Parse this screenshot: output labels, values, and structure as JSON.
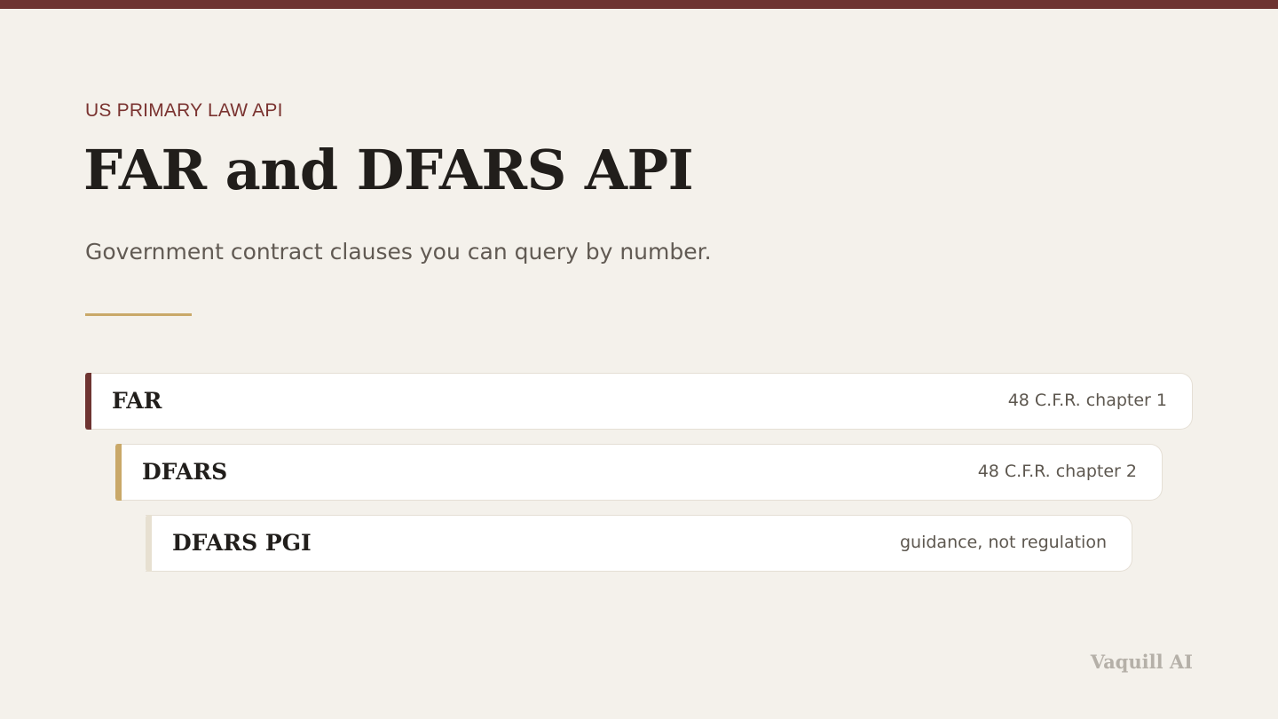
{
  "header": {
    "eyebrow": "US PRIMARY LAW API",
    "title": "FAR and DFARS API",
    "subtitle": "Government contract clauses you can query by number."
  },
  "regulations": [
    {
      "name": "FAR",
      "citation": "48 C.F.R. chapter 1",
      "accent_color": "#6e3431"
    },
    {
      "name": "DFARS",
      "citation": "48 C.F.R. chapter 2",
      "accent_color": "#c9a868"
    },
    {
      "name": "DFARS PGI",
      "citation": "guidance, not regulation",
      "accent_color": "#e7e0d1"
    }
  ],
  "footer": {
    "brand": "Vaquill AI"
  },
  "colors": {
    "brand": "#6e3431",
    "accent": "#c9a868",
    "background": "#f4f1eb",
    "text": "#211e1b"
  }
}
